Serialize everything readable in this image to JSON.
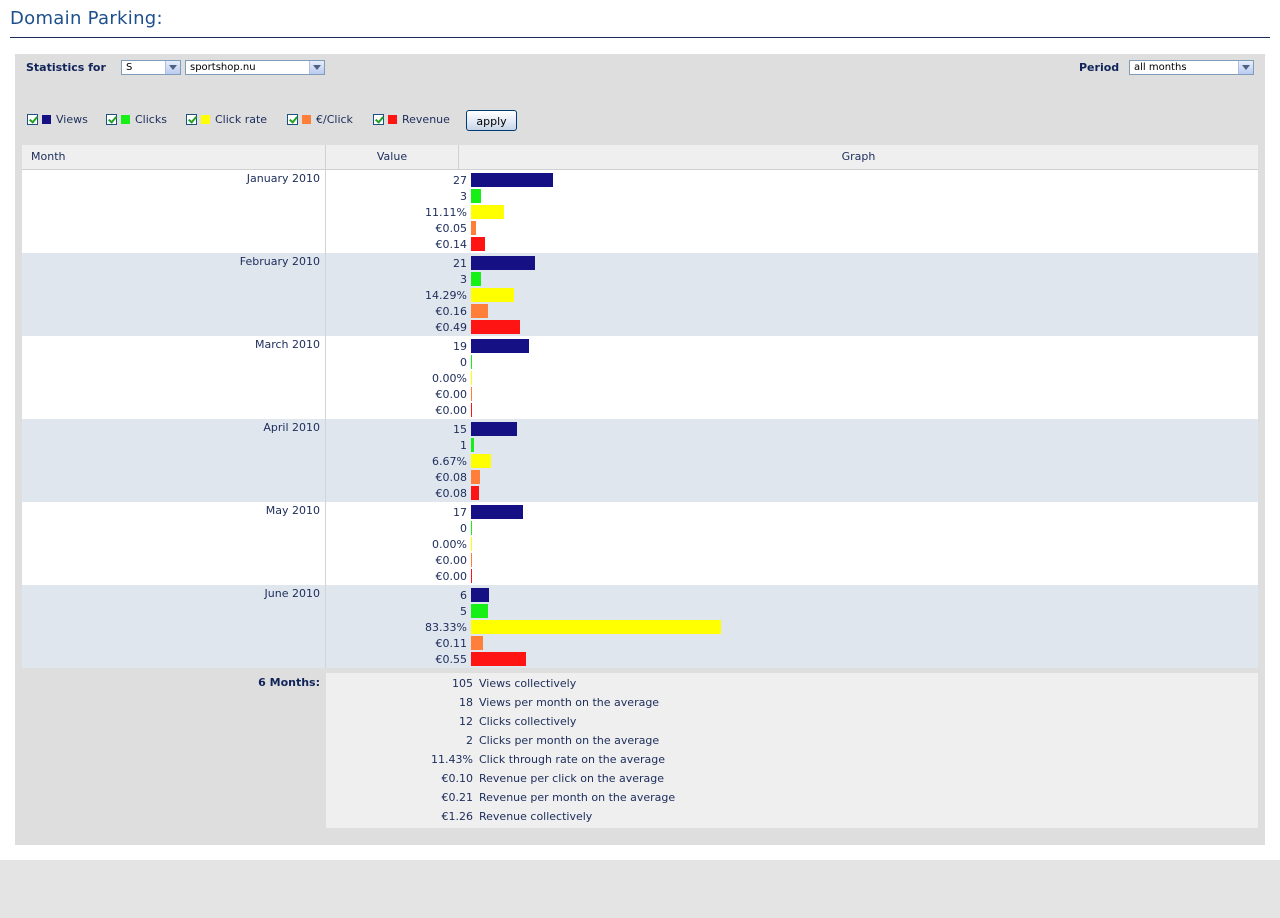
{
  "page_title": "Domain Parking:",
  "filters": {
    "statistics_label": "Statistics for",
    "type_value": "S",
    "domain_value": "sportshop.nu",
    "period_label": "Period",
    "period_value": "all months"
  },
  "legend": [
    {
      "label": "Views",
      "color": "#151184",
      "checked": true
    },
    {
      "label": "Clicks",
      "color": "#16f016",
      "checked": true
    },
    {
      "label": "Click rate",
      "color": "#ffff00",
      "checked": true
    },
    {
      "label": "€/Click",
      "color": "#ff7f3a",
      "checked": true
    },
    {
      "label": "Revenue",
      "color": "#ff1414",
      "checked": true
    }
  ],
  "apply_label": "apply",
  "table": {
    "headers": {
      "month": "Month",
      "value": "Value",
      "graph": "Graph"
    },
    "rows": [
      {
        "month": "January 2010",
        "values": [
          "27",
          "3",
          "11.11%",
          "€0.05",
          "€0.14"
        ],
        "levels": [
          27,
          3,
          11.11,
          0.05,
          0.14
        ]
      },
      {
        "month": "February 2010",
        "values": [
          "21",
          "3",
          "14.29%",
          "€0.16",
          "€0.49"
        ],
        "levels": [
          21,
          3,
          14.29,
          0.16,
          0.49
        ]
      },
      {
        "month": "March 2010",
        "values": [
          "19",
          "0",
          "0.00%",
          "€0.00",
          "€0.00"
        ],
        "levels": [
          19,
          0,
          0,
          0,
          0
        ]
      },
      {
        "month": "April 2010",
        "values": [
          "15",
          "1",
          "6.67%",
          "€0.08",
          "€0.08"
        ],
        "levels": [
          15,
          1,
          6.67,
          0.08,
          0.08
        ]
      },
      {
        "month": "May 2010",
        "values": [
          "17",
          "0",
          "0.00%",
          "€0.00",
          "€0.00"
        ],
        "levels": [
          17,
          0,
          0,
          0,
          0
        ]
      },
      {
        "month": "June 2010",
        "values": [
          "6",
          "5",
          "83.33%",
          "€0.11",
          "€0.55"
        ],
        "levels": [
          6,
          5,
          83.33,
          0.11,
          0.55
        ]
      }
    ]
  },
  "summary": {
    "label": "6 Months:",
    "lines": [
      {
        "value": "105",
        "text": "Views collectively"
      },
      {
        "value": "18",
        "text": "Views per month on the average"
      },
      {
        "value": "12",
        "text": "Clicks collectively"
      },
      {
        "value": "2",
        "text": "Clicks per month on the average"
      },
      {
        "value": "11.43%",
        "text": "Click through rate on the average"
      },
      {
        "value": "€0.10",
        "text": "Revenue per click on the average"
      },
      {
        "value": "€0.21",
        "text": "Revenue per month on the average"
      },
      {
        "value": "€1.26",
        "text": "Revenue collectively"
      }
    ]
  }
}
